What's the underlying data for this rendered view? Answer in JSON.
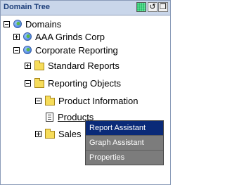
{
  "panel": {
    "title": "Domain Tree",
    "buttons": [
      {
        "name": "green-status-icon",
        "glyph": ""
      },
      {
        "name": "refresh-icon",
        "glyph": "↺"
      },
      {
        "name": "window-icon",
        "glyph": "❐"
      }
    ]
  },
  "tree": {
    "domains": "Domains",
    "aaa": "AAA Grinds Corp",
    "corporate": "Corporate Reporting",
    "standard": "Standard Reports",
    "reporting_objects": "Reporting Objects",
    "product_information": "Product Information",
    "products": "Products",
    "sales": "Sales"
  },
  "context_menu": {
    "items": [
      "Report Assistant",
      "Graph Assistant",
      "Properties"
    ]
  }
}
